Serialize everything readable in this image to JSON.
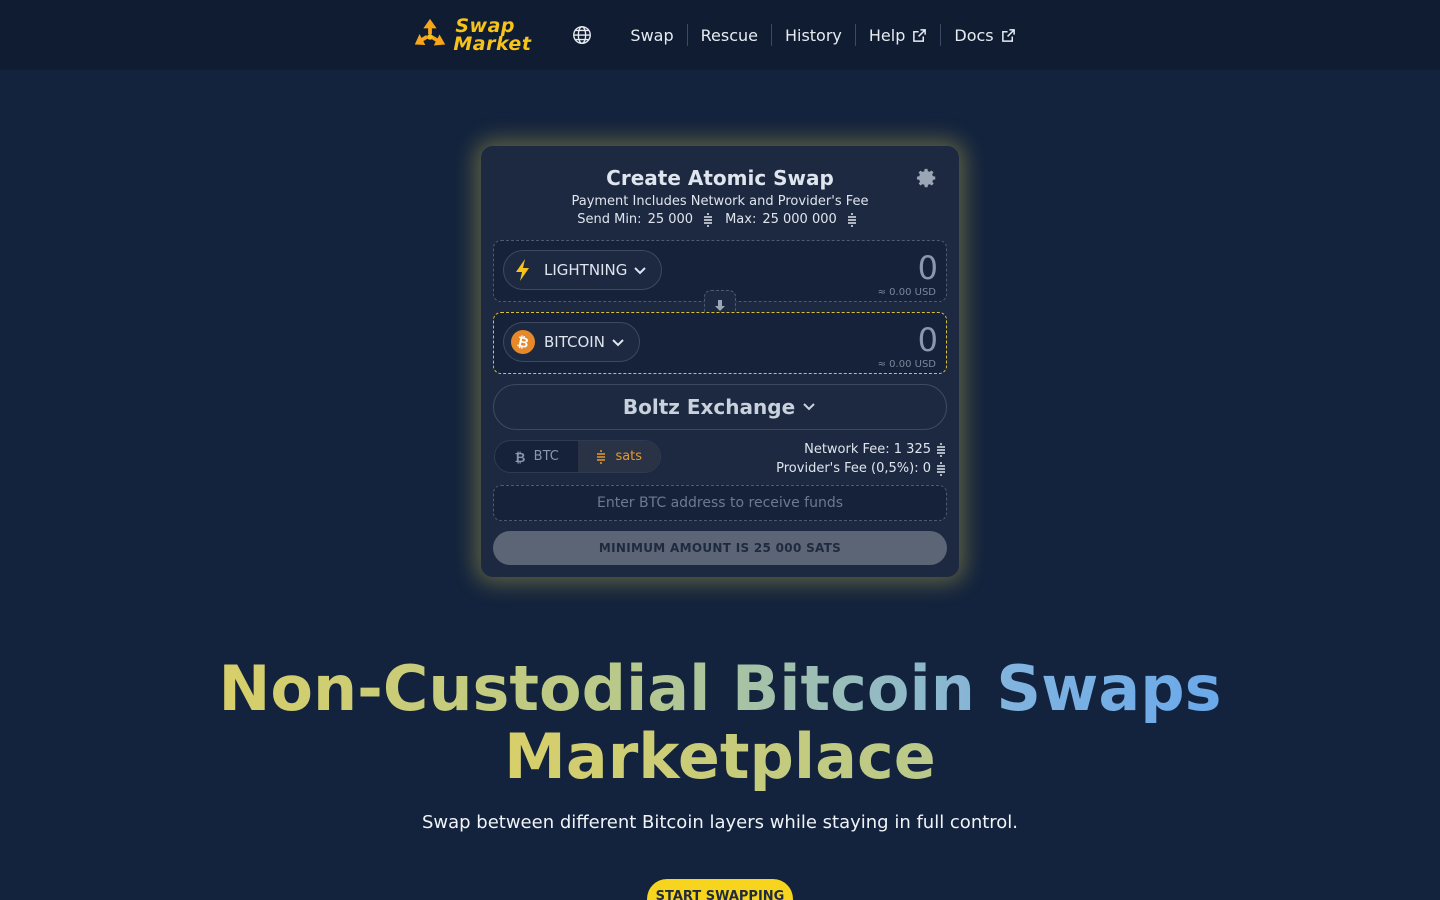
{
  "brand": {
    "line1": "Swap",
    "line2": "Market"
  },
  "nav": {
    "swap": "Swap",
    "rescue": "Rescue",
    "history": "History",
    "help": "Help",
    "docs": "Docs"
  },
  "card": {
    "title": "Create Atomic Swap",
    "subtitle": "Payment Includes Network and Provider's Fee",
    "min_label": "Send Min:",
    "min_value": "25 000",
    "max_label": "Max:",
    "max_value": "25 000 000",
    "from": {
      "asset": "LIGHTNING",
      "amount": "0",
      "usd": "≈ 0.00 USD"
    },
    "to": {
      "asset": "BITCOIN",
      "amount": "0",
      "usd": "≈ 0.00 USD"
    },
    "provider": "Boltz Exchange",
    "denom": {
      "btc": "BTC",
      "sats": "sats",
      "selected": "sats"
    },
    "network_fee": "Network Fee: 1 325",
    "provider_fee": "Provider's Fee (0,5%): 0",
    "address_placeholder": "Enter BTC address to receive funds",
    "button": "MINIMUM AMOUNT IS 25 000 SATS"
  },
  "hero": {
    "title_line1": "Non-Custodial Bitcoin Swaps",
    "title_line2": "Marketplace",
    "subtitle": "Swap between different Bitcoin layers while staying in full control.",
    "cta": "START SWAPPING"
  },
  "colors": {
    "accent": "#f7c21a",
    "background": "#13233d",
    "nav": "#0f1c31"
  }
}
